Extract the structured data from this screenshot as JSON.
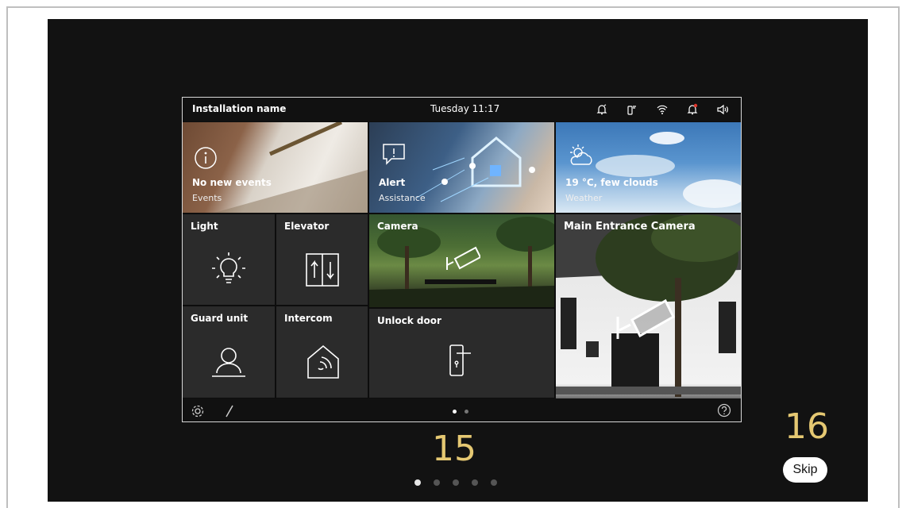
{
  "device": {
    "installation_name": "Installation name",
    "datetime": "Tuesday  11:17",
    "status_icons": [
      "bell-mute-icon",
      "door-phone-icon",
      "wifi-icon",
      "alarm-bell-icon",
      "speaker-icon"
    ]
  },
  "tiles": {
    "events": {
      "main": "No new events",
      "sub": "Events"
    },
    "assistance": {
      "main": "Alert",
      "sub": "Assistance"
    },
    "weather": {
      "main": "19 °C, few clouds",
      "sub": "Weather"
    },
    "light": {
      "title": "Light"
    },
    "elevator": {
      "title": "Elevator"
    },
    "camera": {
      "title": "Camera"
    },
    "main_camera": {
      "title": "Main Entrance Camera"
    },
    "guard": {
      "title": "Guard unit"
    },
    "intercom": {
      "title": "Intercom"
    },
    "unlock": {
      "title": "Unlock door"
    }
  },
  "device_pages": {
    "count": 2,
    "active": 0
  },
  "walkthrough": {
    "current_step": "15",
    "next_step": "16",
    "skip_label": "Skip",
    "pager_count": 5,
    "pager_active": 0
  },
  "colors": {
    "accent": "#e5c872",
    "stage": "#121212",
    "tile": "#2b2b2b"
  }
}
